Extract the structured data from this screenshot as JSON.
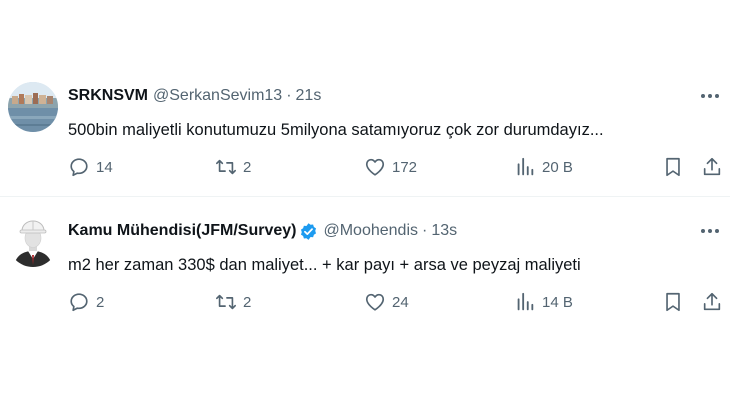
{
  "tweets": [
    {
      "display_name": "SRKNSVM",
      "verified": false,
      "handle": "@SerkanSevim13",
      "separator": "·",
      "time": "21s",
      "text": "500bin maliyetli konutumuzu 5milyona satamıyoruz çok zor durumdayız...",
      "avatar_icon": "harbor-photo-avatar",
      "replies": "14",
      "retweets": "2",
      "likes": "172",
      "views": "20 B"
    },
    {
      "display_name": "Kamu Mühendisi(JFM/Survey)",
      "verified": true,
      "handle": "@Moohendis",
      "separator": "·",
      "time": "13s",
      "text": "m2 her zaman 330$ dan maliyet... + kar payı + arsa ve peyzaj maliyeti",
      "avatar_icon": "engineer-avatar",
      "replies": "2",
      "retweets": "2",
      "likes": "24",
      "views": "14 B"
    }
  ],
  "icons": {
    "more": "more-horizontal-icon",
    "reply": "reply-icon",
    "retweet": "retweet-icon",
    "like": "heart-icon",
    "views": "views-chart-icon",
    "bookmark": "bookmark-icon",
    "share": "share-icon",
    "verified": "verified-badge-icon"
  },
  "colors": {
    "text_primary": "#0f1419",
    "text_secondary": "#536471",
    "verified_blue": "#1d9bf0",
    "divider": "#eff3f4"
  }
}
